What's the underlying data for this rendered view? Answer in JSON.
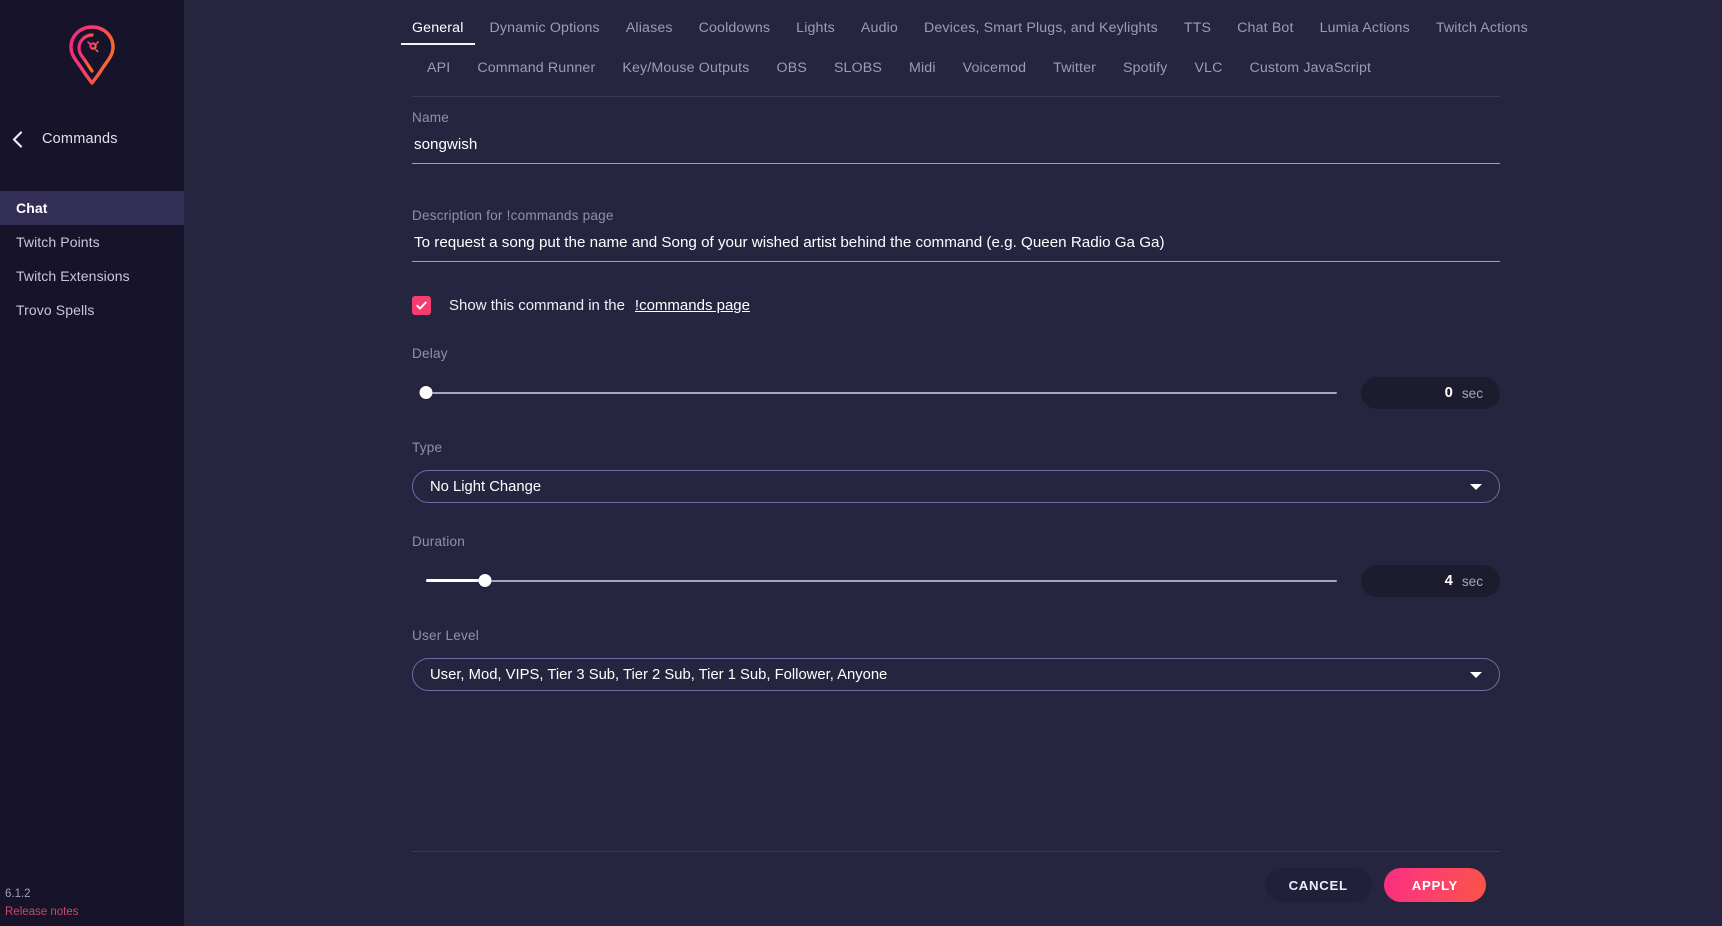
{
  "sidebar": {
    "logo_name": "lumia-lightbulb-logo",
    "back_icon": "chevron-left-icon",
    "back_title": "Commands",
    "items": [
      {
        "label": "Chat",
        "active": true
      },
      {
        "label": "Twitch Points",
        "active": false
      },
      {
        "label": "Twitch Extensions",
        "active": false
      },
      {
        "label": "Trovo Spells",
        "active": false
      }
    ],
    "version": "6.1.2",
    "release_notes": "Release notes"
  },
  "tabs": {
    "row1": [
      {
        "label": "General",
        "active": true
      },
      {
        "label": "Dynamic Options",
        "active": false
      },
      {
        "label": "Aliases",
        "active": false
      },
      {
        "label": "Cooldowns",
        "active": false
      },
      {
        "label": "Lights",
        "active": false
      },
      {
        "label": "Audio",
        "active": false
      },
      {
        "label": "Devices, Smart Plugs, and Keylights",
        "active": false
      },
      {
        "label": "TTS",
        "active": false
      },
      {
        "label": "Chat Bot",
        "active": false
      },
      {
        "label": "Lumia Actions",
        "active": false
      },
      {
        "label": "Twitch Actions",
        "active": false
      }
    ],
    "row2": [
      {
        "label": "API",
        "active": false
      },
      {
        "label": "Command Runner",
        "active": false
      },
      {
        "label": "Key/Mouse Outputs",
        "active": false
      },
      {
        "label": "OBS",
        "active": false
      },
      {
        "label": "SLOBS",
        "active": false
      },
      {
        "label": "Midi",
        "active": false
      },
      {
        "label": "Voicemod",
        "active": false
      },
      {
        "label": "Twitter",
        "active": false
      },
      {
        "label": "Spotify",
        "active": false
      },
      {
        "label": "VLC",
        "active": false
      },
      {
        "label": "Custom JavaScript",
        "active": false
      }
    ]
  },
  "form": {
    "name": {
      "label": "Name",
      "value": "songwish",
      "placeholder": "Name"
    },
    "description": {
      "label": "Description for !commands page",
      "value": "To request a song put the name and Song of your wished artist behind the command (e.g. Queen Radio Ga Ga)",
      "placeholder": "Description for !commands page"
    },
    "show_in_commands": {
      "checked": true,
      "check_glyph": "✓",
      "label": "Show this command in the",
      "link_label": "!commands page",
      "accent_color": "#f63d70"
    },
    "delay": {
      "label": "Delay",
      "value": "0",
      "unit": "sec",
      "percent": 0,
      "min": 0,
      "max": 60
    },
    "type": {
      "label": "Type",
      "value": "No Light Change",
      "caret_icon": "chevron-down-icon"
    },
    "duration": {
      "label": "Duration",
      "value": "4",
      "unit": "sec",
      "percent": 6.5,
      "min": 0,
      "max": 60
    },
    "user_level": {
      "label": "User Level",
      "value": "User, Mod, VIPS, Tier 3 Sub, Tier 2 Sub, Tier 1 Sub, Follower, Anyone",
      "caret_icon": "chevron-down-icon"
    }
  },
  "footer": {
    "cancel_label": "CANCEL",
    "apply_label": "APPLY",
    "apply_gradient_from": "#fb2d7f",
    "apply_gradient_to": "#fa5445"
  }
}
